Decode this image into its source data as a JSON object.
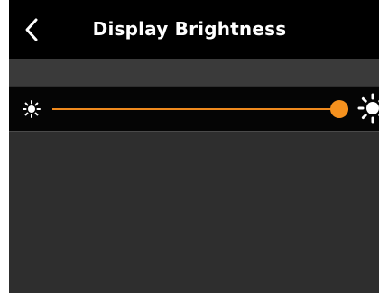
{
  "header": {
    "title": "Display Brightness",
    "back_icon": "chevron-left-icon"
  },
  "brightness": {
    "min_icon": "sun-small-icon",
    "max_icon": "sun-large-icon",
    "level_fraction": 1.0
  },
  "colors": {
    "header_bg": "#000000",
    "screen_bg": "#2e2e2e",
    "accent": "#f5911e",
    "text": "#ffffff"
  }
}
